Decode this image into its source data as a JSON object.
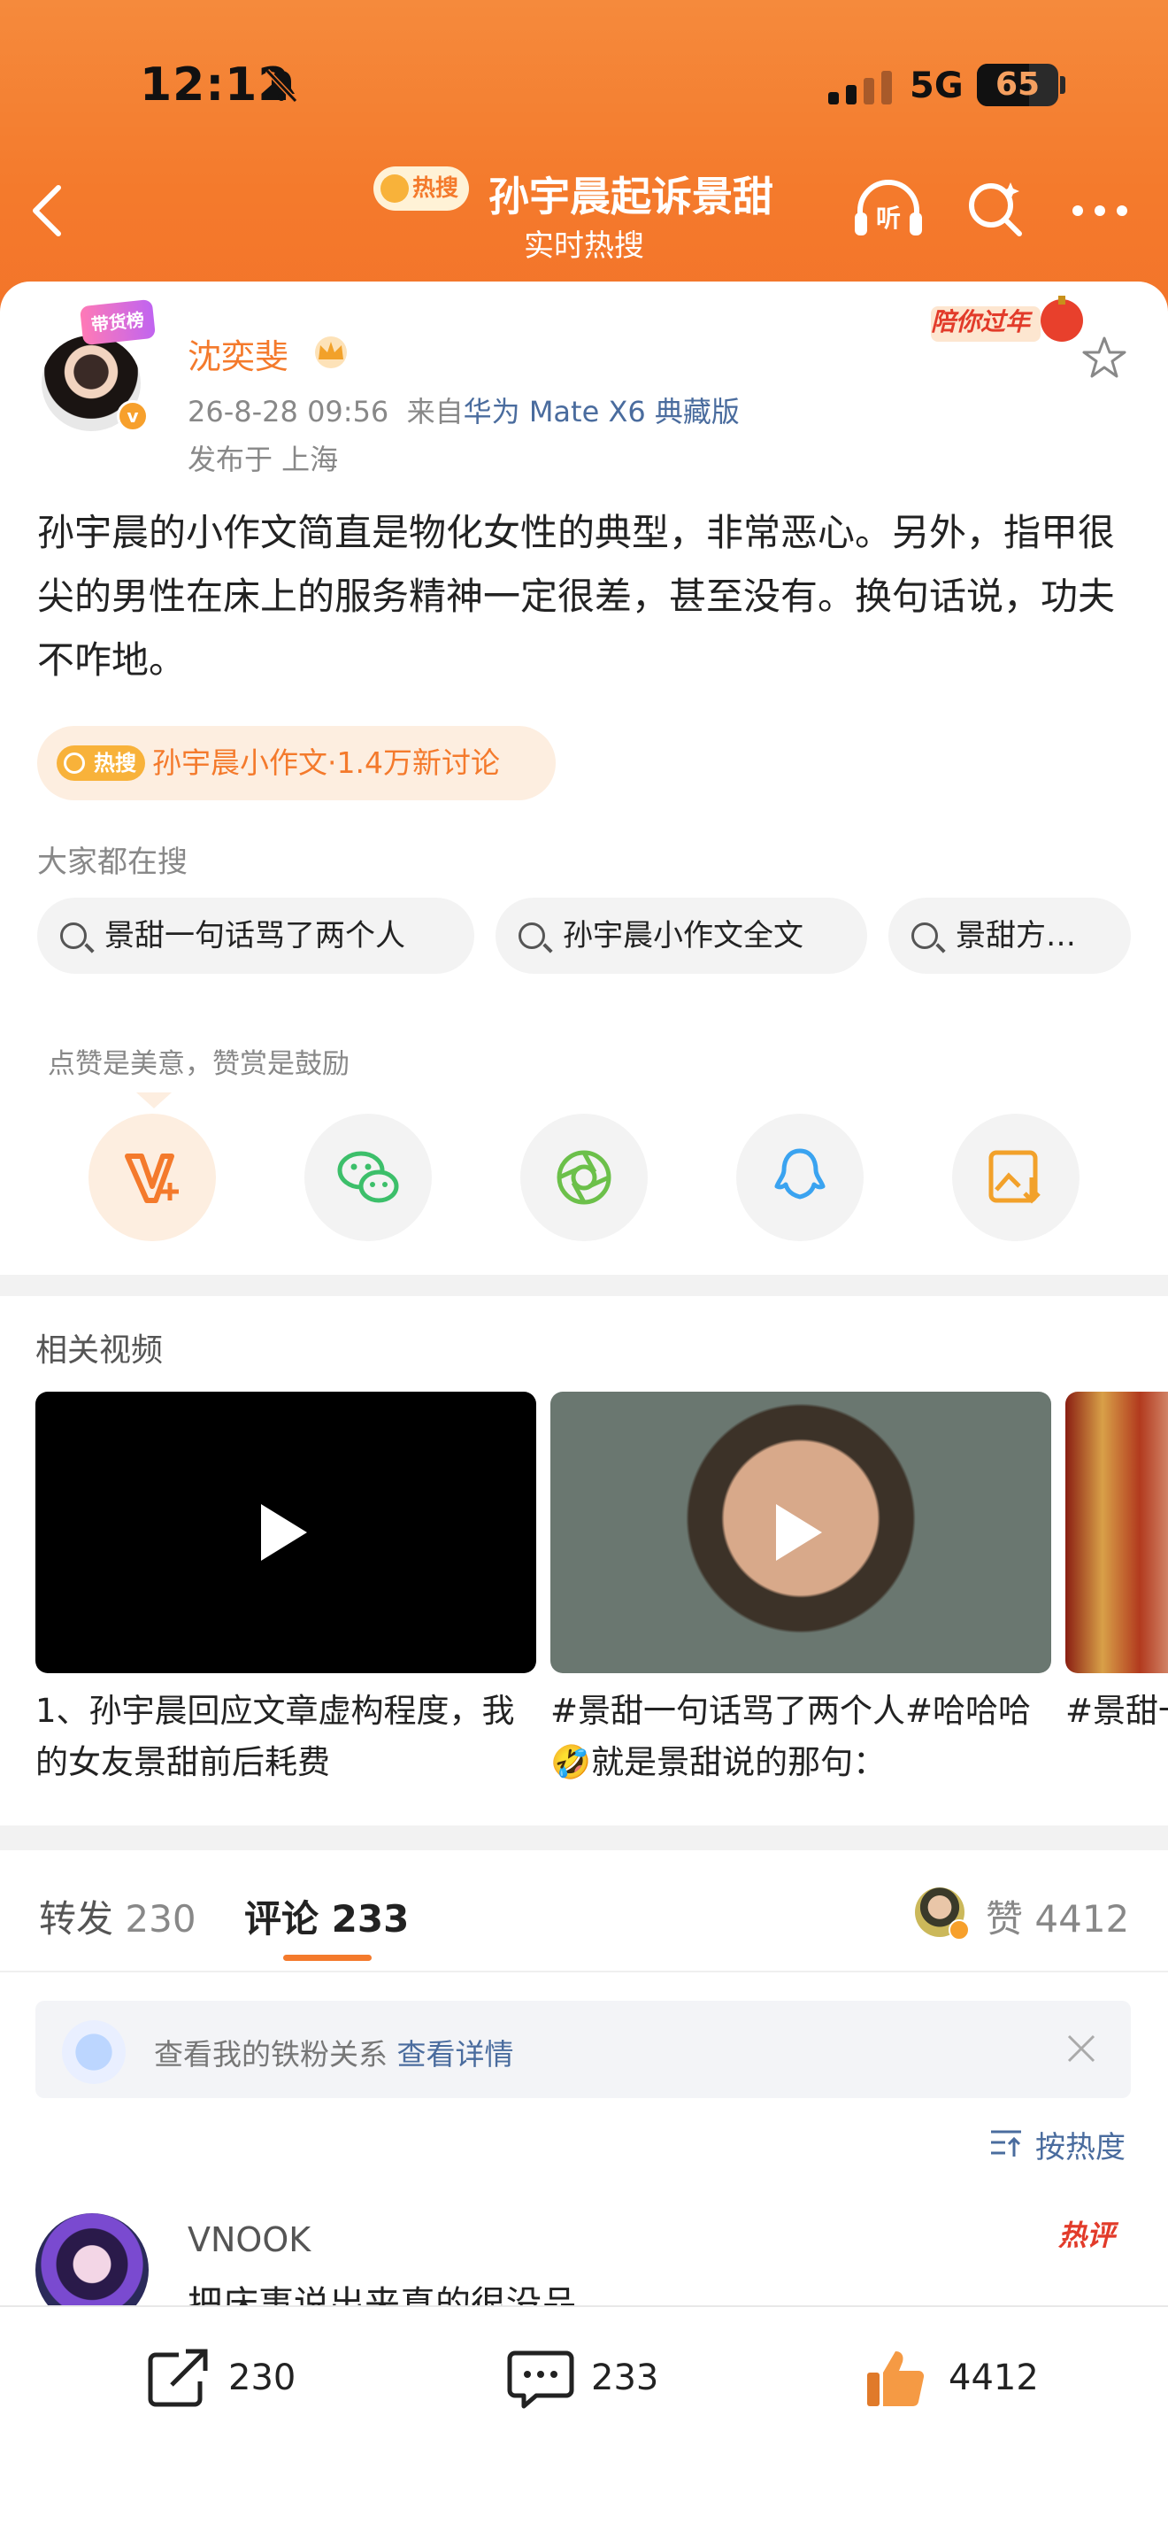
{
  "status_bar": {
    "time": "12:12",
    "network": "5G",
    "battery": "65"
  },
  "header": {
    "hot_badge": "热搜",
    "title": "孙宇晨起诉景甜",
    "subtitle": "实时热搜",
    "listen_label": "听"
  },
  "post": {
    "author": "沈奕斐",
    "avatar_badge": "带货榜",
    "timestamp": "26-8-28 09:56",
    "source_prefix": "来自",
    "device": "华为 Mate X6 典藏版",
    "location": "发布于 上海",
    "new_year_badge": "陪你过年",
    "text": "孙宇晨的小作文简直是物化女性的典型，非常恶心。另外，指甲很尖的男性在床上的服务精神一定很差，甚至没有。换句话说，功夫不咋地。",
    "topic_badge": "热搜",
    "topic": "孙宇晨小作文·1.4万新讨论"
  },
  "searching": {
    "label": "大家都在搜",
    "chips": [
      "景甜一句话骂了两个人",
      "孙宇晨小作文全文",
      "景甜方…"
    ]
  },
  "share": {
    "praise_text": "点赞是美意，赞赏是鼓励",
    "buttons": [
      "reward",
      "wechat",
      "moments",
      "qq",
      "save-image"
    ]
  },
  "related_videos": {
    "heading": "相关视频",
    "items": [
      {
        "caption": "1、孙宇晨回应文章虚构程度，我的女友景甜前后耗费"
      },
      {
        "caption": "#景甜一句话骂了两个人#哈哈哈🤣就是景甜说的那句："
      },
      {
        "caption": "#景甜一句话骂了两个人#景甜曾"
      }
    ]
  },
  "tabs": {
    "repost_label": "转发",
    "repost_count": "230",
    "comment_label": "评论",
    "comment_count": "233",
    "like_label": "赞",
    "like_count": "4412"
  },
  "iron_fan": {
    "text": "查看我的铁粉关系",
    "link": "查看详情"
  },
  "sort": {
    "label": "按热度"
  },
  "comment": {
    "user": "VNOOK",
    "badge": "热评",
    "text": "把床事说出来真的很没品"
  },
  "bottom_bar": {
    "repost": "230",
    "comment": "233",
    "like": "4412"
  },
  "colors": {
    "accent": "#f47a2c",
    "link": "#4a6c9e",
    "header_bg": "#f47a2c"
  }
}
